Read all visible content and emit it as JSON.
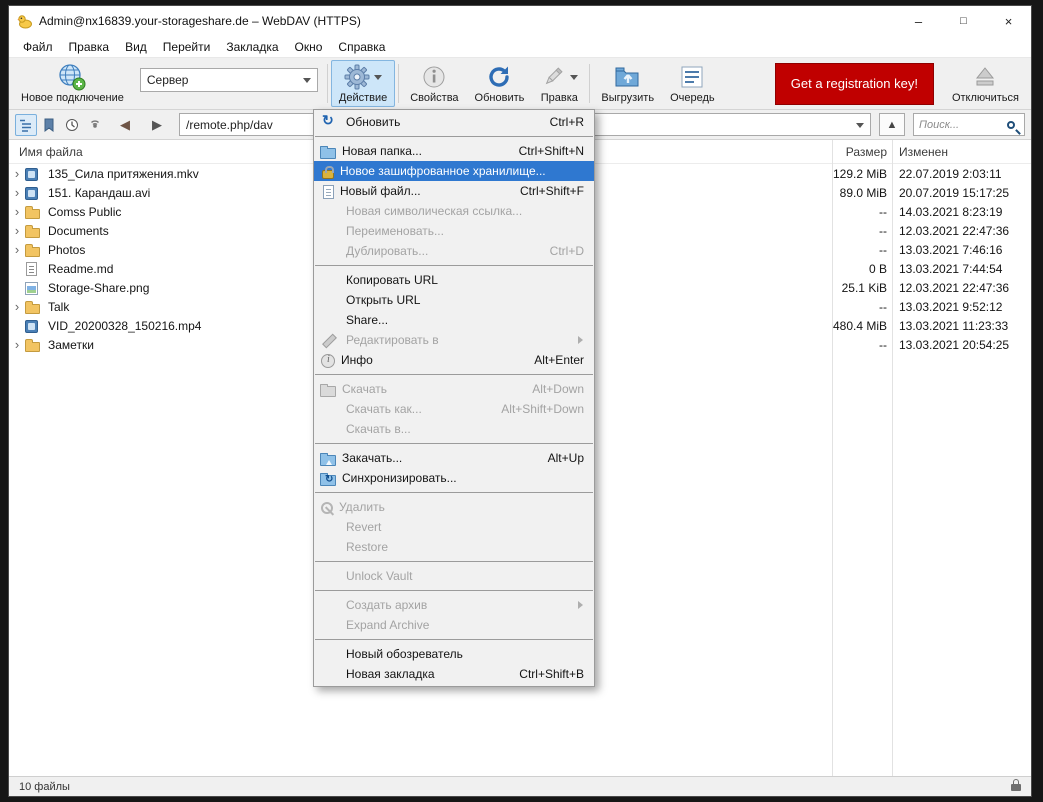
{
  "window": {
    "title": "Admin@nx16839.your-storageshare.de – WebDAV (HTTPS)",
    "controls": {
      "minimize": "–",
      "maximize": "□",
      "close": "×"
    }
  },
  "menubar": {
    "items": [
      "Файл",
      "Правка",
      "Вид",
      "Перейти",
      "Закладка",
      "Окно",
      "Справка"
    ]
  },
  "toolbar": {
    "new_connection": "Новое подключение",
    "server_value": "Сервер",
    "action": "Действие",
    "properties": "Свойства",
    "refresh": "Обновить",
    "edit": "Правка",
    "upload": "Выгрузить",
    "queue": "Очередь",
    "registration": "Get a registration key!",
    "disconnect": "Отключиться"
  },
  "pathbar": {
    "path": "/remote.php/dav",
    "search_placeholder": "Поиск..."
  },
  "icons": {
    "back": "◀",
    "forward": "▶",
    "up": "▲"
  },
  "colors": {
    "accent_blue": "#2f78d0",
    "registration_red": "#c00000",
    "folder_yellow": "#f2c462"
  },
  "filelist": {
    "columns": [
      "Имя файла",
      "Размер",
      "Изменен"
    ],
    "expander_glyph": "›",
    "rows": [
      {
        "name": "135_Сила притяжения.mkv",
        "size": "129.2 MiB",
        "modified": "22.07.2019 2:03:11",
        "icon": "video",
        "expandable": true
      },
      {
        "name": "151. Карандаш.avi",
        "size": "89.0 MiB",
        "modified": "20.07.2019 15:17:25",
        "icon": "video",
        "expandable": true
      },
      {
        "name": "Comss Public",
        "size": "--",
        "modified": "14.03.2021 8:23:19",
        "icon": "folder",
        "expandable": true
      },
      {
        "name": "Documents",
        "size": "--",
        "modified": "12.03.2021 22:47:36",
        "icon": "folder",
        "expandable": true
      },
      {
        "name": "Photos",
        "size": "--",
        "modified": "13.03.2021 7:46:16",
        "icon": "folder",
        "expandable": true
      },
      {
        "name": "Readme.md",
        "size": "0 B",
        "modified": "13.03.2021 7:44:54",
        "icon": "doc",
        "expandable": false
      },
      {
        "name": "Storage-Share.png",
        "size": "25.1 KiB",
        "modified": "12.03.2021 22:47:36",
        "icon": "image",
        "expandable": false
      },
      {
        "name": "Talk",
        "size": "--",
        "modified": "13.03.2021 9:52:12",
        "icon": "folder",
        "expandable": true
      },
      {
        "name": "VID_20200328_150216.mp4",
        "size": "480.4 MiB",
        "modified": "13.03.2021 11:23:33",
        "icon": "video",
        "expandable": false
      },
      {
        "name": "Заметки",
        "size": "--",
        "modified": "13.03.2021 20:54:25",
        "icon": "folder",
        "expandable": true
      }
    ]
  },
  "action_menu": {
    "items": [
      {
        "label": "Обновить",
        "shortcut": "Ctrl+R",
        "icon": "refresh"
      },
      {
        "sep": true
      },
      {
        "label": "Новая папка...",
        "shortcut": "Ctrl+Shift+N",
        "icon": "folder-new"
      },
      {
        "label": "Новое зашифрованное хранилище...",
        "icon": "vault",
        "highlight": true
      },
      {
        "label": "Новый файл...",
        "shortcut": "Ctrl+Shift+F",
        "icon": "file-new"
      },
      {
        "label": "Новая символическая ссылка...",
        "disabled": true
      },
      {
        "label": "Переименовать...",
        "disabled": true
      },
      {
        "label": "Дублировать...",
        "shortcut": "Ctrl+D",
        "disabled": true
      },
      {
        "sep": true
      },
      {
        "label": "Копировать URL"
      },
      {
        "label": "Открыть URL"
      },
      {
        "label": "Share..."
      },
      {
        "label": "Редактировать в",
        "disabled": true,
        "submenu": true,
        "icon": "pencil"
      },
      {
        "label": "Инфо",
        "shortcut": "Alt+Enter",
        "icon": "info"
      },
      {
        "sep": true
      },
      {
        "label": "Скачать",
        "shortcut": "Alt+Down",
        "disabled": true,
        "icon": "download"
      },
      {
        "label": "Скачать как...",
        "shortcut": "Alt+Shift+Down",
        "disabled": true
      },
      {
        "label": "Скачать в...",
        "disabled": true
      },
      {
        "sep": true
      },
      {
        "label": "Закачать...",
        "shortcut": "Alt+Up",
        "icon": "upload"
      },
      {
        "label": "Синхронизировать...",
        "icon": "sync"
      },
      {
        "sep": true
      },
      {
        "label": "Удалить",
        "disabled": true,
        "icon": "delete"
      },
      {
        "label": "Revert",
        "disabled": true
      },
      {
        "label": "Restore",
        "disabled": true
      },
      {
        "sep": true
      },
      {
        "label": "Unlock Vault",
        "disabled": true
      },
      {
        "sep": true
      },
      {
        "label": "Создать архив",
        "disabled": true,
        "submenu": true
      },
      {
        "label": "Expand Archive",
        "disabled": true
      },
      {
        "sep": true
      },
      {
        "label": "Новый обозреватель"
      },
      {
        "label": "Новая закладка",
        "shortcut": "Ctrl+Shift+B"
      }
    ]
  },
  "statusbar": {
    "text": "10 файлы"
  }
}
